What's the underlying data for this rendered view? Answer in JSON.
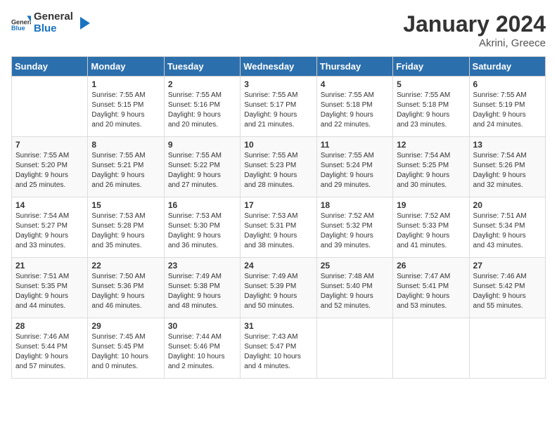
{
  "header": {
    "logo": {
      "general": "General",
      "blue": "Blue"
    },
    "title": "January 2024",
    "subtitle": "Akrini, Greece"
  },
  "weekdays": [
    "Sunday",
    "Monday",
    "Tuesday",
    "Wednesday",
    "Thursday",
    "Friday",
    "Saturday"
  ],
  "weeks": [
    [
      {
        "day": "",
        "info": ""
      },
      {
        "day": "1",
        "info": "Sunrise: 7:55 AM\nSunset: 5:15 PM\nDaylight: 9 hours\nand 20 minutes."
      },
      {
        "day": "2",
        "info": "Sunrise: 7:55 AM\nSunset: 5:16 PM\nDaylight: 9 hours\nand 20 minutes."
      },
      {
        "day": "3",
        "info": "Sunrise: 7:55 AM\nSunset: 5:17 PM\nDaylight: 9 hours\nand 21 minutes."
      },
      {
        "day": "4",
        "info": "Sunrise: 7:55 AM\nSunset: 5:18 PM\nDaylight: 9 hours\nand 22 minutes."
      },
      {
        "day": "5",
        "info": "Sunrise: 7:55 AM\nSunset: 5:18 PM\nDaylight: 9 hours\nand 23 minutes."
      },
      {
        "day": "6",
        "info": "Sunrise: 7:55 AM\nSunset: 5:19 PM\nDaylight: 9 hours\nand 24 minutes."
      }
    ],
    [
      {
        "day": "7",
        "info": "Sunrise: 7:55 AM\nSunset: 5:20 PM\nDaylight: 9 hours\nand 25 minutes."
      },
      {
        "day": "8",
        "info": "Sunrise: 7:55 AM\nSunset: 5:21 PM\nDaylight: 9 hours\nand 26 minutes."
      },
      {
        "day": "9",
        "info": "Sunrise: 7:55 AM\nSunset: 5:22 PM\nDaylight: 9 hours\nand 27 minutes."
      },
      {
        "day": "10",
        "info": "Sunrise: 7:55 AM\nSunset: 5:23 PM\nDaylight: 9 hours\nand 28 minutes."
      },
      {
        "day": "11",
        "info": "Sunrise: 7:55 AM\nSunset: 5:24 PM\nDaylight: 9 hours\nand 29 minutes."
      },
      {
        "day": "12",
        "info": "Sunrise: 7:54 AM\nSunset: 5:25 PM\nDaylight: 9 hours\nand 30 minutes."
      },
      {
        "day": "13",
        "info": "Sunrise: 7:54 AM\nSunset: 5:26 PM\nDaylight: 9 hours\nand 32 minutes."
      }
    ],
    [
      {
        "day": "14",
        "info": "Sunrise: 7:54 AM\nSunset: 5:27 PM\nDaylight: 9 hours\nand 33 minutes."
      },
      {
        "day": "15",
        "info": "Sunrise: 7:53 AM\nSunset: 5:28 PM\nDaylight: 9 hours\nand 35 minutes."
      },
      {
        "day": "16",
        "info": "Sunrise: 7:53 AM\nSunset: 5:30 PM\nDaylight: 9 hours\nand 36 minutes."
      },
      {
        "day": "17",
        "info": "Sunrise: 7:53 AM\nSunset: 5:31 PM\nDaylight: 9 hours\nand 38 minutes."
      },
      {
        "day": "18",
        "info": "Sunrise: 7:52 AM\nSunset: 5:32 PM\nDaylight: 9 hours\nand 39 minutes."
      },
      {
        "day": "19",
        "info": "Sunrise: 7:52 AM\nSunset: 5:33 PM\nDaylight: 9 hours\nand 41 minutes."
      },
      {
        "day": "20",
        "info": "Sunrise: 7:51 AM\nSunset: 5:34 PM\nDaylight: 9 hours\nand 43 minutes."
      }
    ],
    [
      {
        "day": "21",
        "info": "Sunrise: 7:51 AM\nSunset: 5:35 PM\nDaylight: 9 hours\nand 44 minutes."
      },
      {
        "day": "22",
        "info": "Sunrise: 7:50 AM\nSunset: 5:36 PM\nDaylight: 9 hours\nand 46 minutes."
      },
      {
        "day": "23",
        "info": "Sunrise: 7:49 AM\nSunset: 5:38 PM\nDaylight: 9 hours\nand 48 minutes."
      },
      {
        "day": "24",
        "info": "Sunrise: 7:49 AM\nSunset: 5:39 PM\nDaylight: 9 hours\nand 50 minutes."
      },
      {
        "day": "25",
        "info": "Sunrise: 7:48 AM\nSunset: 5:40 PM\nDaylight: 9 hours\nand 52 minutes."
      },
      {
        "day": "26",
        "info": "Sunrise: 7:47 AM\nSunset: 5:41 PM\nDaylight: 9 hours\nand 53 minutes."
      },
      {
        "day": "27",
        "info": "Sunrise: 7:46 AM\nSunset: 5:42 PM\nDaylight: 9 hours\nand 55 minutes."
      }
    ],
    [
      {
        "day": "28",
        "info": "Sunrise: 7:46 AM\nSunset: 5:44 PM\nDaylight: 9 hours\nand 57 minutes."
      },
      {
        "day": "29",
        "info": "Sunrise: 7:45 AM\nSunset: 5:45 PM\nDaylight: 10 hours\nand 0 minutes."
      },
      {
        "day": "30",
        "info": "Sunrise: 7:44 AM\nSunset: 5:46 PM\nDaylight: 10 hours\nand 2 minutes."
      },
      {
        "day": "31",
        "info": "Sunrise: 7:43 AM\nSunset: 5:47 PM\nDaylight: 10 hours\nand 4 minutes."
      },
      {
        "day": "",
        "info": ""
      },
      {
        "day": "",
        "info": ""
      },
      {
        "day": "",
        "info": ""
      }
    ]
  ]
}
